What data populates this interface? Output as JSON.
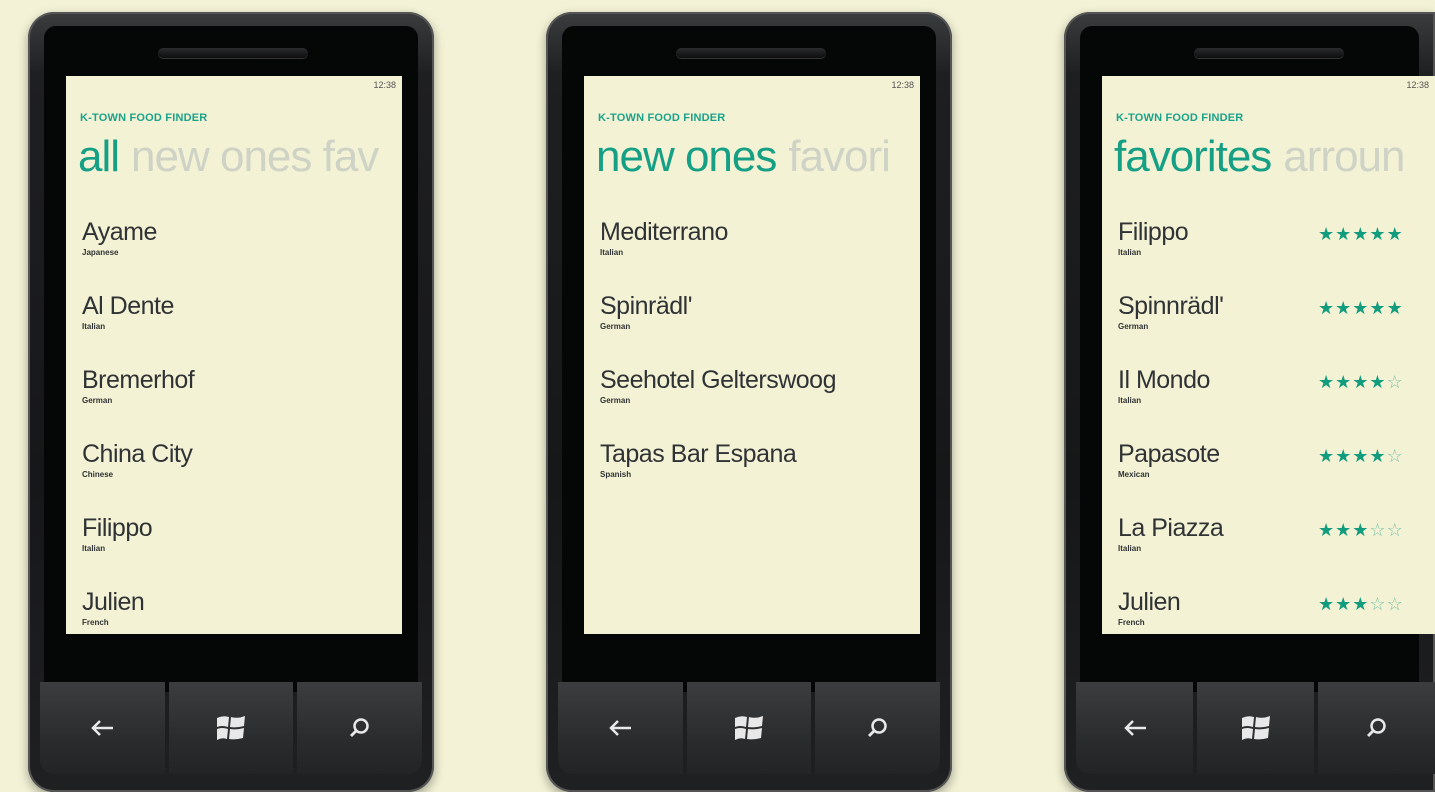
{
  "phones": [
    {
      "clock": "12:38",
      "app_title": "K-TOWN FOOD FINDER",
      "pivot_active": "all",
      "pivot_next": "new ones fav",
      "items": [
        {
          "name": "Ayame",
          "cuisine": "Japanese"
        },
        {
          "name": "Al Dente",
          "cuisine": "Italian"
        },
        {
          "name": "Bremerhof",
          "cuisine": "German"
        },
        {
          "name": "China City",
          "cuisine": "Chinese"
        },
        {
          "name": "Filippo",
          "cuisine": "Italian"
        },
        {
          "name": "Julien",
          "cuisine": "French"
        }
      ]
    },
    {
      "clock": "12:38",
      "app_title": "K-TOWN FOOD FINDER",
      "pivot_active": "new ones",
      "pivot_next": "favori",
      "items": [
        {
          "name": "Mediterrano",
          "cuisine": "Italian"
        },
        {
          "name": "Spinrädl'",
          "cuisine": "German"
        },
        {
          "name": "Seehotel Gelterswoog",
          "cuisine": "German"
        },
        {
          "name": "Tapas Bar Espana",
          "cuisine": "Spanish"
        }
      ]
    },
    {
      "clock": "12:38",
      "app_title": "K-TOWN FOOD FINDER",
      "pivot_active": "favorites",
      "pivot_next": "arroun",
      "items": [
        {
          "name": "Filippo",
          "cuisine": "Italian",
          "rating": 5
        },
        {
          "name": "Spinnrädl'",
          "cuisine": "German",
          "rating": 5
        },
        {
          "name": "Il Mondo",
          "cuisine": "Italian",
          "rating": 4
        },
        {
          "name": "Papasote",
          "cuisine": "Mexican",
          "rating": 4
        },
        {
          "name": "La Piazza",
          "cuisine": "Italian",
          "rating": 3
        },
        {
          "name": "Julien",
          "cuisine": "French",
          "rating": 3
        }
      ]
    }
  ],
  "rating_max": 5,
  "hardware_buttons": {
    "back_icon": "back-arrow-icon",
    "start_icon": "windows-logo-icon",
    "search_icon": "search-icon"
  },
  "colors": {
    "accent": "#15a085",
    "background": "#f3f2d6",
    "screen": "#f4f2d4",
    "text": "#2f3335",
    "inactive_pivot": "#cfd3c6"
  }
}
